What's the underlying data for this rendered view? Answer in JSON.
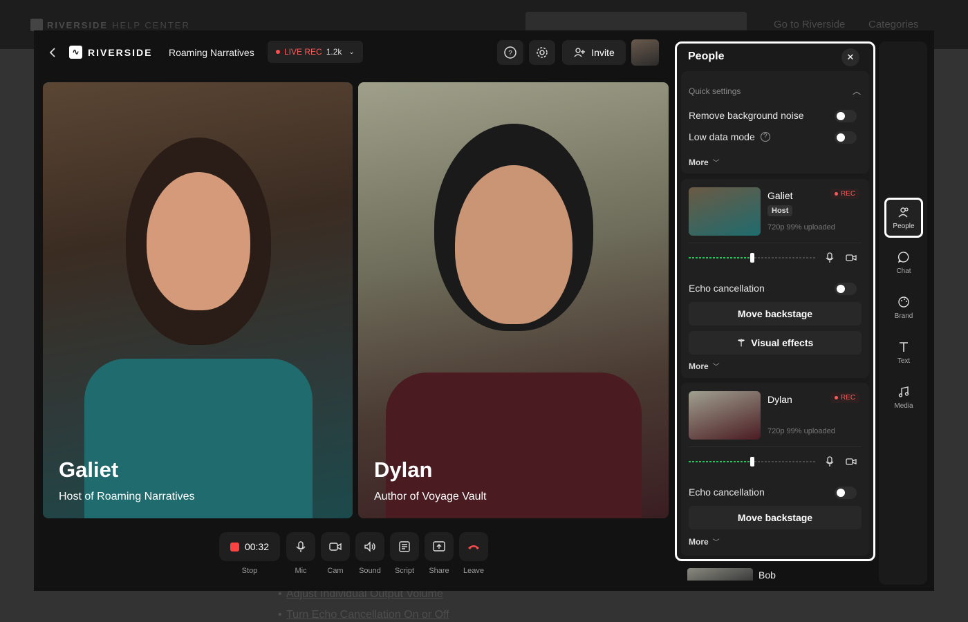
{
  "background_page": {
    "brand": "RIVERSIDE",
    "brand_sub": "HELP CENTER",
    "nav": [
      "Go to Riverside",
      "Categories"
    ],
    "links": [
      "Adjust Individual Output Volume",
      "Turn Echo Cancellation On or Off"
    ]
  },
  "topbar": {
    "logo": "RIVERSIDE",
    "project_title": "Roaming Narratives",
    "live_label": "LIVE REC",
    "live_count": "1.2k",
    "invite_label": "Invite"
  },
  "tiles": [
    {
      "name": "Galiet",
      "role": "Host of Roaming Narratives"
    },
    {
      "name": "Dylan",
      "role": "Author of Voyage Vault"
    }
  ],
  "controls": {
    "timer": "00:32",
    "labels": [
      "Stop",
      "Mic",
      "Cam",
      "Sound",
      "Script",
      "Share",
      "Leave"
    ]
  },
  "panel": {
    "title": "People",
    "quick_settings": "Quick settings",
    "remove_noise": "Remove background noise",
    "low_data": "Low data mode",
    "more": "More",
    "participants": [
      {
        "name": "Galiet",
        "badge": "Host",
        "rec": "REC",
        "meta": "720p  99% uploaded",
        "echo": "Echo cancellation",
        "move": "Move backstage",
        "effects": "Visual effects",
        "more": "More",
        "volume_fraction": 0.5
      },
      {
        "name": "Dylan",
        "rec": "REC",
        "meta": "720p  99% uploaded",
        "echo": "Echo cancellation",
        "move": "Move backstage",
        "more": "More",
        "volume_fraction": 0.5
      }
    ],
    "next_participant": "Bob"
  },
  "rail": [
    "People",
    "Chat",
    "Brand",
    "Text",
    "Media"
  ],
  "colors": {
    "accent_red": "#ff4d4d",
    "meter_green": "#22c55e",
    "panel_bg": "#1a1a1a"
  }
}
